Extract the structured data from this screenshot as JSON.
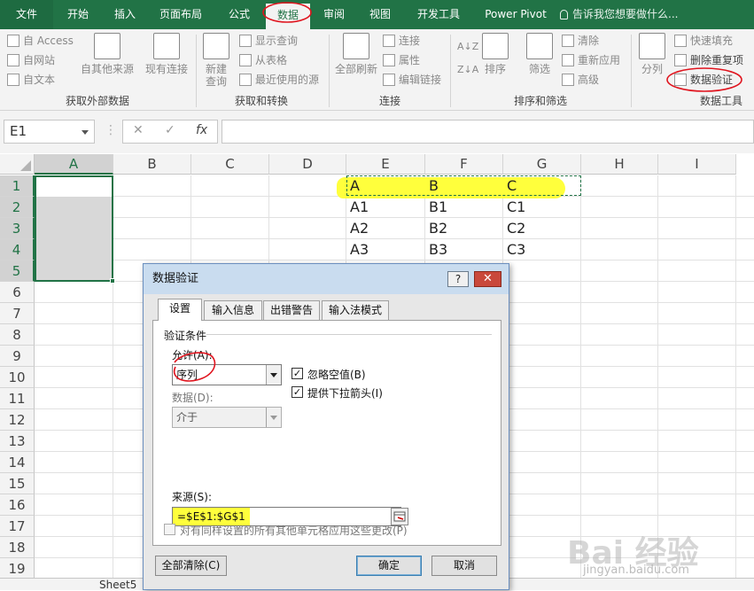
{
  "tabs": [
    {
      "label": "文件",
      "id": "file"
    },
    {
      "label": "开始",
      "id": "home"
    },
    {
      "label": "插入",
      "id": "insert"
    },
    {
      "label": "页面布局",
      "id": "layout"
    },
    {
      "label": "公式",
      "id": "formulas"
    },
    {
      "label": "数据",
      "id": "data"
    },
    {
      "label": "审阅",
      "id": "review"
    },
    {
      "label": "视图",
      "id": "view"
    },
    {
      "label": "开发工具",
      "id": "developer"
    },
    {
      "label": "Power Pivot",
      "id": "powerpivot"
    }
  ],
  "tellme": "告诉我您想要做什么...",
  "ribbon": {
    "ext": {
      "access": "自 Access",
      "web": "自网站",
      "text": "自文本",
      "other": "自其他来源",
      "existing": "现有连接",
      "group": "获取外部数据"
    },
    "transform": {
      "newquery": "新建\n查询",
      "show": "显示查询",
      "table": "从表格",
      "recent": "最近使用的源",
      "group": "获取和转换"
    },
    "conn": {
      "refresh": "全部刷新",
      "connections": "连接",
      "properties": "属性",
      "edit": "编辑链接",
      "group": "连接"
    },
    "sort": {
      "az": "A↓Z",
      "za": "Z↓A",
      "sort": "排序",
      "filter": "筛选",
      "clear": "清除",
      "reapply": "重新应用",
      "advanced": "高级",
      "group": "排序和筛选"
    },
    "tools": {
      "split": "分列",
      "flash": "快速填充",
      "dedupe": "删除重复项",
      "validation": "数据验证",
      "group": "数据工具"
    }
  },
  "formula": {
    "namebox": "E1",
    "cancel": "✕",
    "enter": "✓",
    "fx": "fx",
    "value": ""
  },
  "columns": [
    "A",
    "B",
    "C",
    "D",
    "E",
    "F",
    "G",
    "H",
    "I"
  ],
  "rows": [
    "1",
    "2",
    "3",
    "4",
    "5",
    "6",
    "7",
    "8",
    "9",
    "10",
    "11",
    "12",
    "13",
    "14",
    "15",
    "16",
    "17",
    "18",
    "19"
  ],
  "cells": {
    "E1": "A",
    "F1": "B",
    "G1": "C",
    "E2": "A1",
    "F2": "B1",
    "G2": "C1",
    "E3": "A2",
    "F3": "B2",
    "G3": "C2",
    "E4": "A3",
    "F4": "B3",
    "G4": "C3"
  },
  "sheet": {
    "tab": "Sheet5"
  },
  "dialog": {
    "title": "数据验证",
    "help": "?",
    "close": "✕",
    "tabs": [
      "设置",
      "输入信息",
      "出错警告",
      "输入法模式"
    ],
    "section": "验证条件",
    "allow_label": "允许(A):",
    "allow_value": "序列",
    "ignore_blank": "忽略空值(B)",
    "dropdown": "提供下拉箭头(I)",
    "data_label": "数据(D):",
    "data_value": "介于",
    "source_label": "来源(S):",
    "source_value": "=$E$1:$G$1",
    "apply_all": "对有同样设置的所有其他单元格应用这些更改(P)",
    "clear_all": "全部清除(C)",
    "ok": "确定",
    "cancel": "取消"
  },
  "watermark": {
    "main": "Bai 经验",
    "sub": "jingyan.baidu.com"
  },
  "colors": {
    "excel_green": "#217346",
    "highlight": "#ffff3c",
    "annotation": "#e0141e"
  }
}
